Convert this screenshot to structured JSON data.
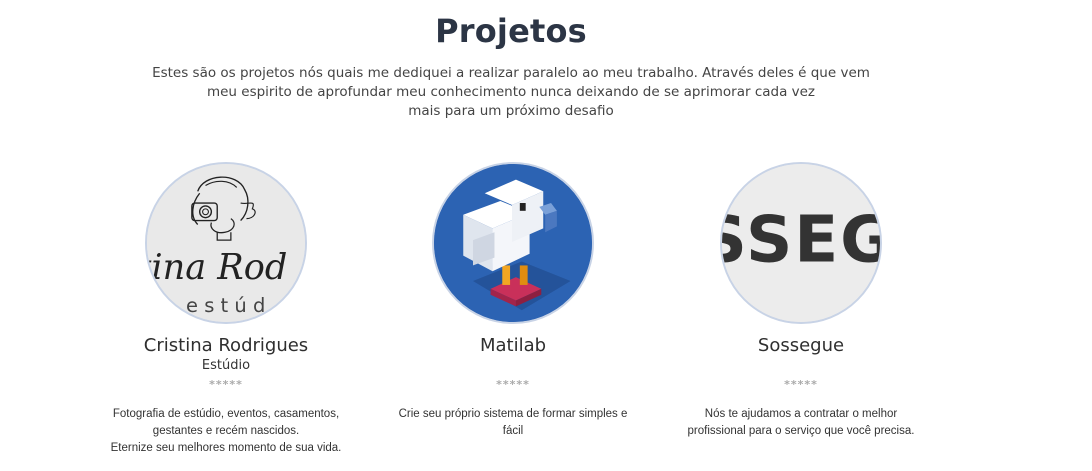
{
  "section": {
    "title": "Projetos",
    "intro": [
      "Estes são os projetos nós quais me dediquei a realizar paralelo ao meu trabalho. Através deles é que vem",
      "meu espirito de aprofundar meu conhecimento nunca deixando de se aprimorar cada vez",
      "mais para um próximo desafio"
    ]
  },
  "projects": [
    {
      "name": "Cristina Rodrigues",
      "subtitle": "Estúdio",
      "rating": "*****",
      "logo_text": "tina Rod",
      "logo_subtext": "e s t ú d",
      "description": [
        "Fotografia de estúdio, eventos, casamentos,",
        "gestantes e recém nascidos.",
        "Eternize seu melhores momento de sua vida."
      ]
    },
    {
      "name": "Matilab",
      "subtitle": "",
      "rating": "*****",
      "description": [
        "Crie seu próprio sistema de formar simples e",
        "fácil"
      ]
    },
    {
      "name": "Sossegue",
      "subtitle": "",
      "rating": "*****",
      "logo_text": "SSEG",
      "description": [
        "Nós te ajudamos a contratar o melhor",
        "profissional para o serviço que você precisa."
      ]
    }
  ]
}
